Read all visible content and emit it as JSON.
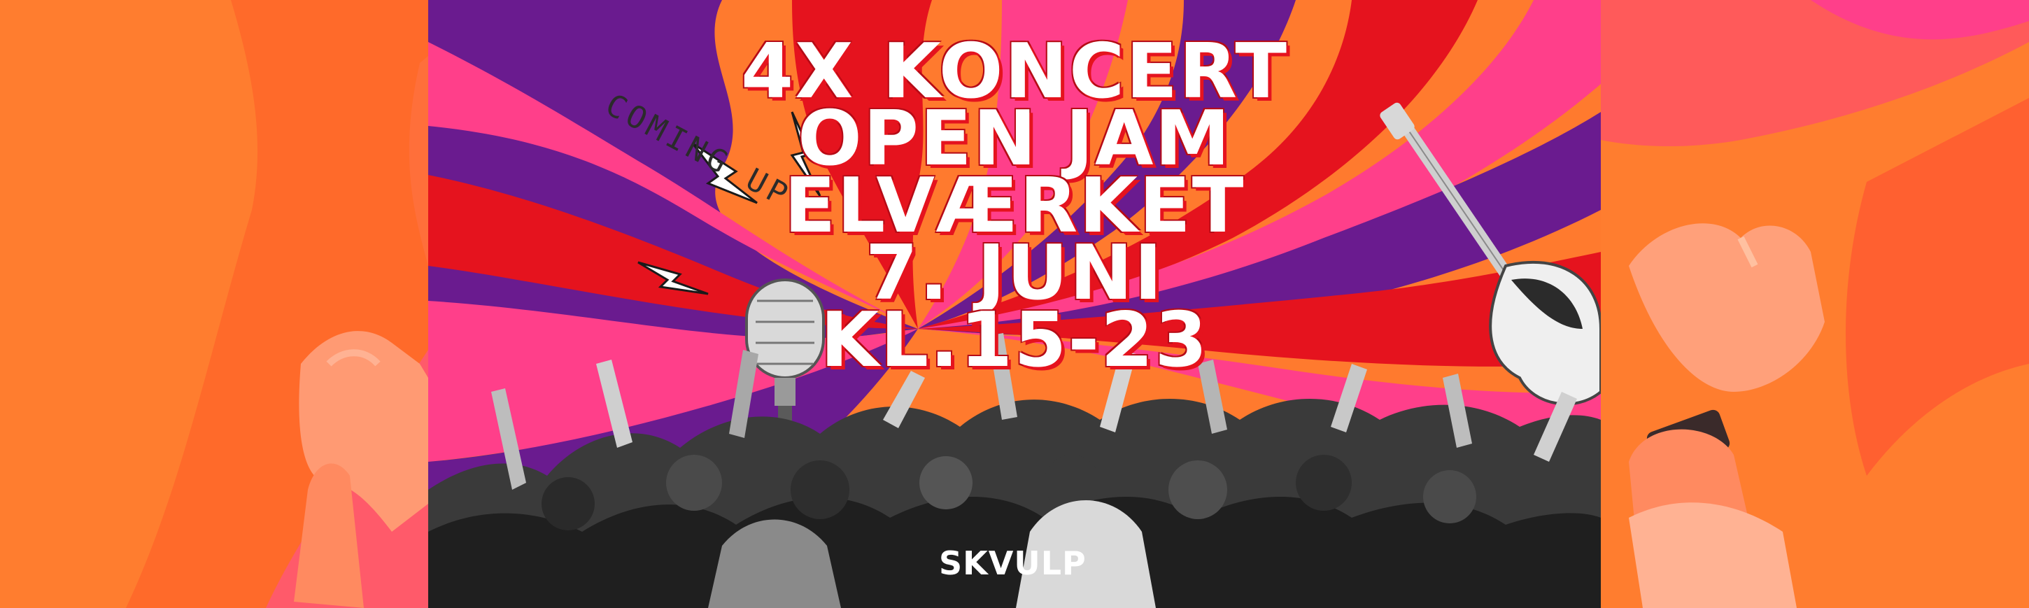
{
  "poster": {
    "headline": {
      "line1": "4X KONCERT",
      "line2": "OPEN JAM",
      "line3": "ELVÆRKET",
      "line4": "7. JUNI",
      "line5": "KL.15-23"
    },
    "tagline": "COMING UP",
    "logo": "SKVULP"
  },
  "colors": {
    "orange": "#ff7a2e",
    "red": "#e5131e",
    "pink": "#ff3f8a",
    "purple": "#6a1b8f",
    "white": "#ffffff"
  },
  "icons": [
    "lightning-bolt-icon",
    "microphone-icon",
    "electric-guitar-icon",
    "raised-fist-icon"
  ]
}
